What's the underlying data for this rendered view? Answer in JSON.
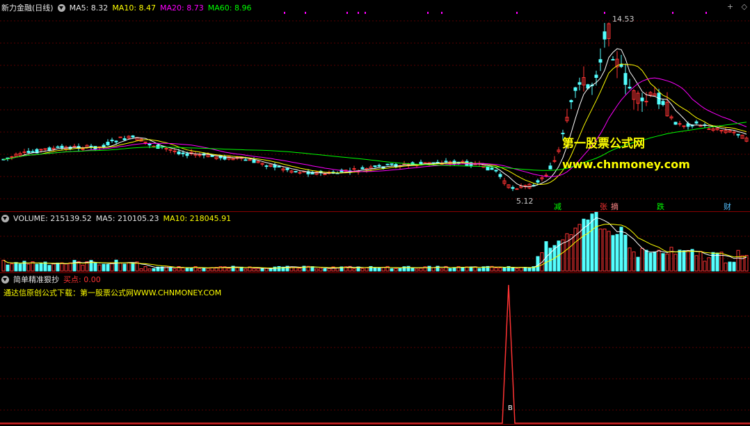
{
  "main_panel": {
    "title": "新力金融(日线)",
    "ma5_label": "MA5: 8.32",
    "ma10_label": "MA10: 8.47",
    "ma20_label": "MA20: 8.73",
    "ma60_label": "MA60: 8.96",
    "high_label": "14.53",
    "low_label": "5.12",
    "watermark_cn": "第一股票公式网",
    "watermark_url": "www.chnmoney.com",
    "tags": [
      "减",
      "张",
      "摘",
      "跌",
      "财"
    ]
  },
  "volume_panel": {
    "volume_label": "VOLUME: 215139.52",
    "ma5_label": "MA5: 210105.23",
    "ma10_label": "MA10: 218045.91"
  },
  "indicator_panel": {
    "title": "简单精准狠抄",
    "buy_label": "买点: 0.00",
    "note": "通达信原创公式下载：第一股票公式网WWW.CHNMONEY.COM",
    "signal_label": "B"
  },
  "corner": {
    "icon1": "plus-icon",
    "icon2": "diamond-icon"
  },
  "colors": {
    "up": "#ff3333",
    "down": "#54ffff",
    "ma5": "#ffffff",
    "ma10": "#ffff00",
    "ma20": "#ff00ff",
    "ma60": "#00ff00",
    "divider": "#8b0000"
  }
}
